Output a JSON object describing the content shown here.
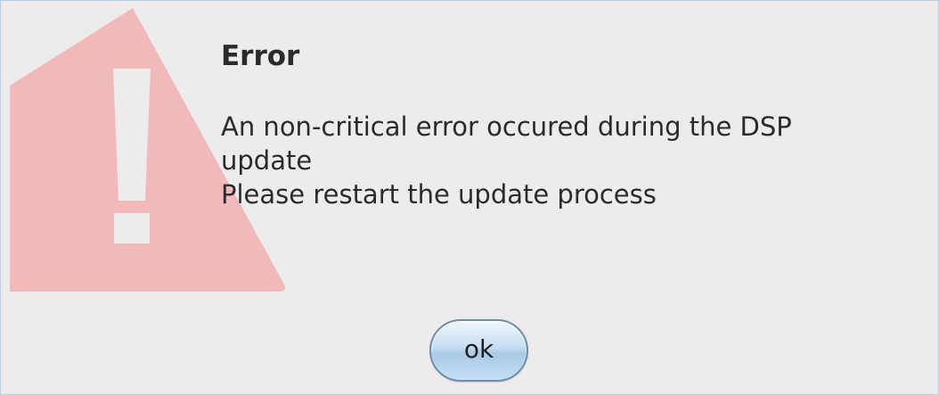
{
  "dialog": {
    "title": "Error",
    "message_lines": [
      "An non-critical error occured during the DSP",
      "update",
      "Please restart the update process"
    ],
    "icon": "warning-triangle-icon",
    "ok_label": "ok"
  },
  "colors": {
    "background": "#edebec",
    "border": "#b8ccde",
    "warning_fill": "#f2b9bb",
    "text": "#2b2b2b",
    "button_accent": "#a9c9e6"
  }
}
